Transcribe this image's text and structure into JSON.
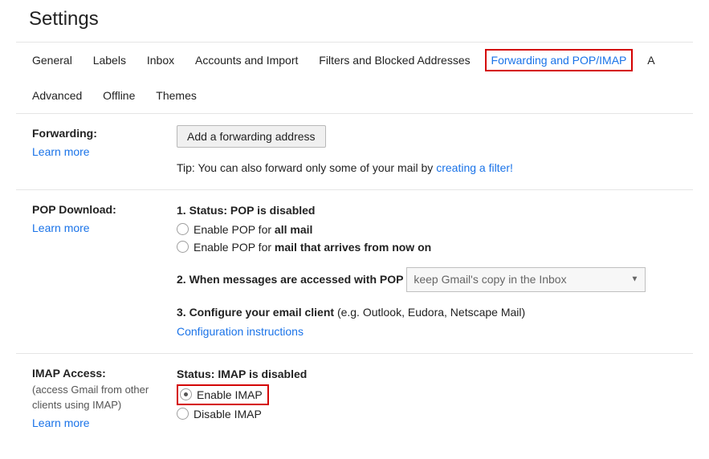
{
  "title": "Settings",
  "tabs": {
    "general": "General",
    "labels": "Labels",
    "inbox": "Inbox",
    "accounts": "Accounts and Import",
    "filters": "Filters and Blocked Addresses",
    "forwarding": "Forwarding and POP/IMAP",
    "trailing": "A",
    "advanced": "Advanced",
    "offline": "Offline",
    "themes": "Themes"
  },
  "forwarding": {
    "heading": "Forwarding:",
    "learn": "Learn more",
    "button": "Add a forwarding address",
    "tip_prefix": "Tip: You can also forward only some of your mail by ",
    "tip_link": "creating a filter!"
  },
  "pop": {
    "heading": "POP Download:",
    "learn": "Learn more",
    "status_label": "1. Status:",
    "status_value": "POP is disabled",
    "opt1_prefix": "Enable POP for ",
    "opt1_bold": "all mail",
    "opt2_prefix": "Enable POP for ",
    "opt2_bold": "mail that arrives from now on",
    "access_label": "2. When messages are accessed with POP",
    "select_value": "keep Gmail's copy in the Inbox",
    "configure_label": "3. Configure your email client",
    "configure_note": "(e.g. Outlook, Eudora, Netscape Mail)",
    "config_link": "Configuration instructions"
  },
  "imap": {
    "heading": "IMAP Access:",
    "sub": "(access Gmail from other clients using IMAP)",
    "learn": "Learn more",
    "status_label": "Status:",
    "status_value": "IMAP is disabled",
    "opt_enable": "Enable IMAP",
    "opt_disable": "Disable IMAP"
  }
}
